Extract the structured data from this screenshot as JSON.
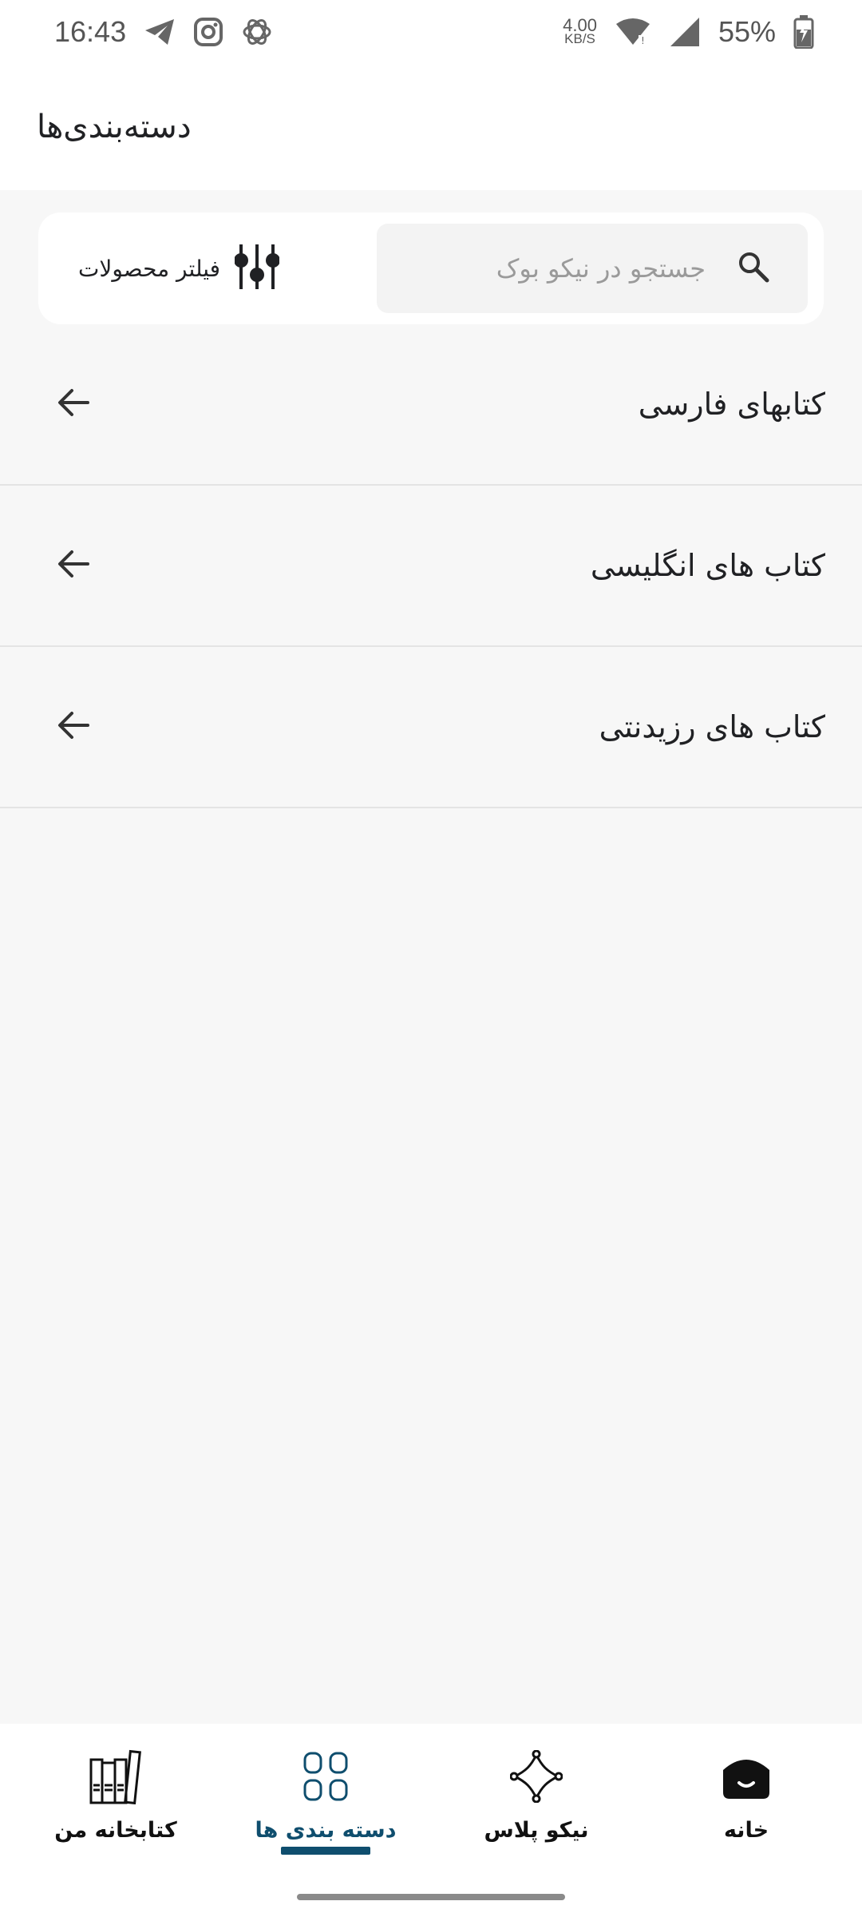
{
  "status_bar": {
    "time": "16:43",
    "net_speed_value": "4.00",
    "net_speed_unit": "KB/S",
    "battery": "55%",
    "icons": [
      "telegram-icon",
      "instagram-icon",
      "openai-icon",
      "wifi-icon",
      "signal-icon",
      "battery-charging-icon"
    ]
  },
  "header": {
    "title": "دسته‌بندی‌ها"
  },
  "search": {
    "placeholder": "جستجو در نیکو بوک",
    "filter_label": "فیلتر محصولات"
  },
  "categories": [
    {
      "label": "کتابهای فارسی"
    },
    {
      "label": "کتاب های انگلیسی"
    },
    {
      "label": "کتاب های رزیدنتی"
    }
  ],
  "bottom_nav": {
    "items": [
      {
        "label": "کتابخانه من",
        "icon": "library-icon"
      },
      {
        "label": "دسته بندی ها",
        "icon": "categories-icon",
        "active": true
      },
      {
        "label": "نیکو پلاس",
        "icon": "nikoo-plus-icon"
      },
      {
        "label": "خانه",
        "icon": "home-icon"
      }
    ]
  },
  "colors": {
    "accent": "#0f4e6e",
    "background": "#f7f7f7",
    "surface": "#ffffff"
  }
}
